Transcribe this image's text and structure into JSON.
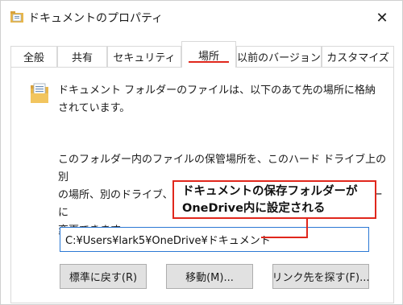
{
  "window": {
    "title": "ドキュメントのプロパティ",
    "close_glyph": "✕"
  },
  "tabs": [
    {
      "label": "全般",
      "active": false
    },
    {
      "label": "共有",
      "active": false
    },
    {
      "label": "セキュリティ",
      "active": false
    },
    {
      "label": "場所",
      "active": true
    },
    {
      "label": "以前のバージョン",
      "active": false
    },
    {
      "label": "カスタマイズ",
      "active": false
    }
  ],
  "location_tab": {
    "folder_description_line1": "ドキュメント フォルダーのファイルは、以下のあて先の場所に格納",
    "folder_description_line2": "されています。",
    "info_line1": "このフォルダー内のファイルの保管場所を、このハード ドライブ上の別",
    "info_line2": "の場所、別のドライブ、またはネットワーク上の別のコンピューターに",
    "info_line3": "変更できます。",
    "path_value": "C:¥Users¥lark5¥OneDrive¥ドキュメント",
    "buttons": {
      "restore": "標準に戻す(R)",
      "move": "移動(M)...",
      "find_target": "リンク先を探す(F)..."
    }
  },
  "annotation": {
    "line1": "ドキュメントの保存フォルダーが",
    "line2": "OneDrive内に設定される",
    "color": "#e0271c"
  },
  "icons": {
    "title": "folder-document-icon",
    "panel": "folder-document-icon",
    "close": "close-icon"
  },
  "colors": {
    "accent_red": "#e0271c",
    "input_border": "#2b78d4",
    "button_bg": "#e1e1e1"
  }
}
